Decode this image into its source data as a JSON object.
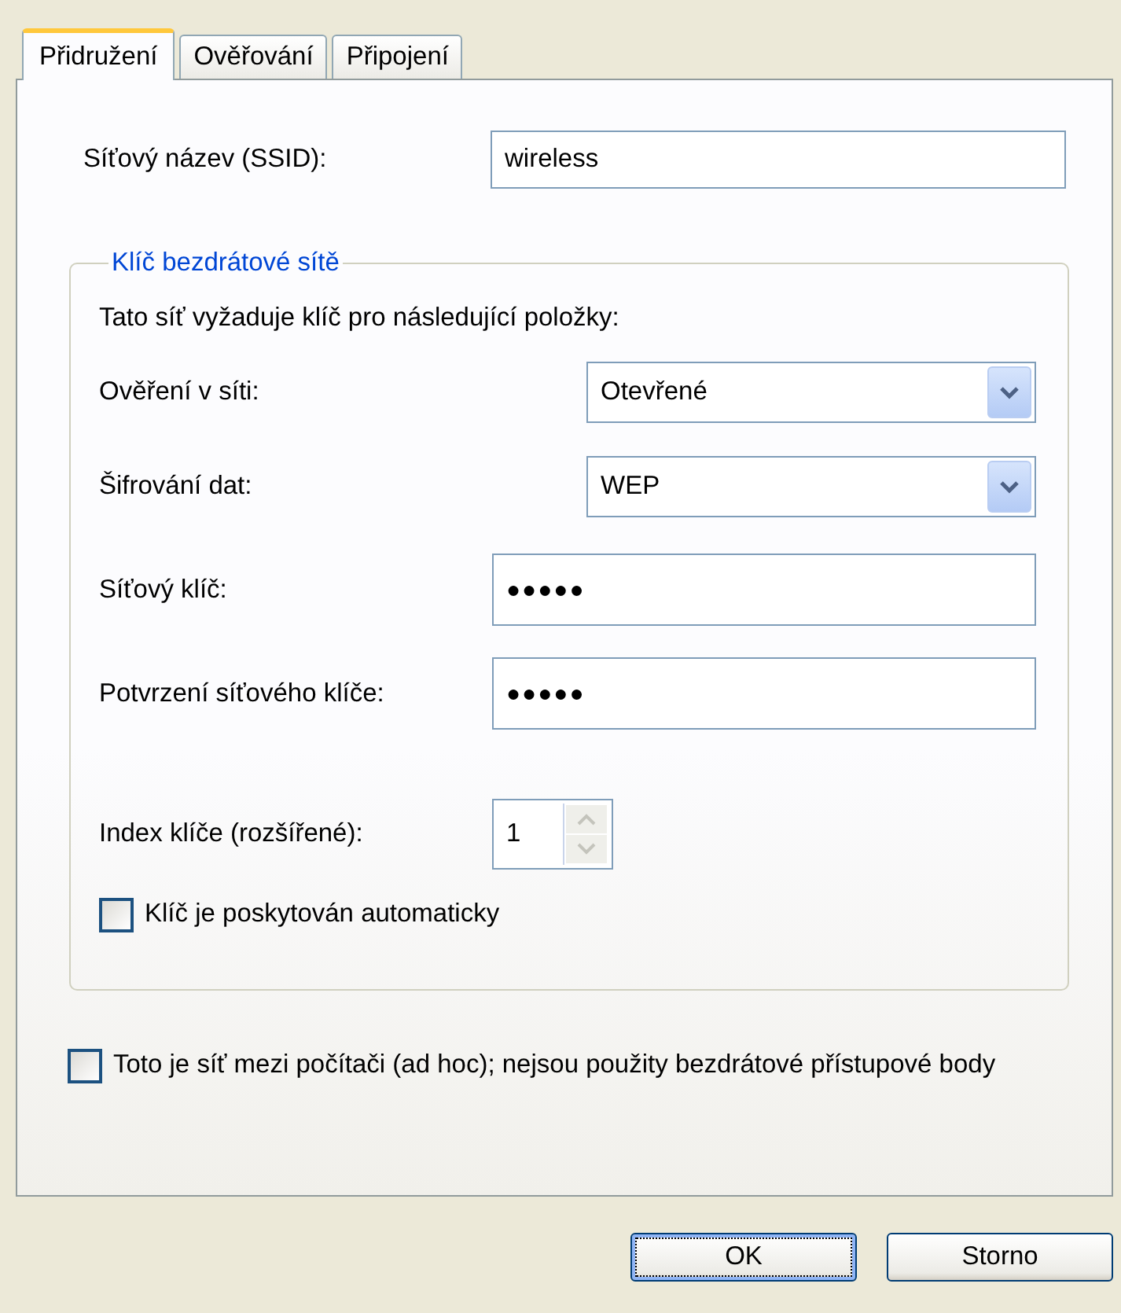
{
  "tabs": [
    {
      "label": "Přidružení",
      "selected": true
    },
    {
      "label": "Ověřování",
      "selected": false
    },
    {
      "label": "Připojení",
      "selected": false
    }
  ],
  "ssid": {
    "label": "Síťový název (SSID):",
    "value": "wireless"
  },
  "key_group": {
    "title": "Klíč bezdrátové sítě",
    "intro": "Tato síť vyžaduje klíč pro následující položky:",
    "fields": [
      {
        "kind": "dropdown",
        "label": "Ověření v síti:",
        "value": "Otevřené"
      },
      {
        "kind": "dropdown",
        "label": "Šifrování dat:",
        "value": "WEP"
      },
      {
        "kind": "password",
        "label": "Síťový klíč:",
        "value": "●●●●●"
      },
      {
        "kind": "password",
        "label": "Potvrzení síťového klíče:",
        "value": "●●●●●"
      },
      {
        "kind": "spinner",
        "label": "Index klíče (rozšířené):",
        "value": "1"
      }
    ],
    "auto_key": {
      "label": "Klíč je poskytován automaticky",
      "checked": false
    }
  },
  "adhoc": {
    "label": "Toto je síť mezi počítači (ad hoc); nejsou použity bezdrátové přístupové body",
    "checked": false
  },
  "buttons": [
    {
      "label": "OK",
      "focused": true
    },
    {
      "label": "Storno",
      "focused": false
    }
  ]
}
